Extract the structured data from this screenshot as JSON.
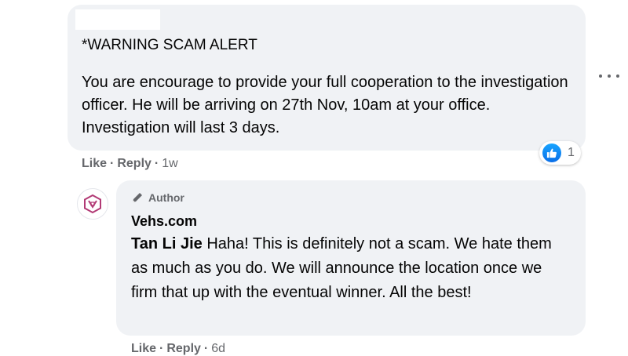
{
  "comment": {
    "title": "*WARNING SCAM ALERT",
    "body": "You are encourage to provide your full cooperation to the investigation officer. He will be arriving on 27th Nov, 10am at your office. Investigation will last 3 days.",
    "like_label": "Like",
    "reply_label": "Reply",
    "time": "1w",
    "reaction_icon": "thumbs-up-icon",
    "reaction_count": "1",
    "more_icon": "more-options-icon"
  },
  "reply": {
    "badge": "Author",
    "badge_icon": "pen-icon",
    "page_name": "Vehs.com",
    "mention": "Tan Li Jie",
    "text": " Haha! This is definitely not a scam. We hate them as much as you do. We will announce the location once we firm that up with the eventual winner. All the best!",
    "like_label": "Like",
    "reply_label": "Reply",
    "time": "6d",
    "avatar_icon": "vehs-logo-icon"
  },
  "colors": {
    "bubble": "#f0f2f5",
    "text": "#050505",
    "secondary": "#65676b",
    "like_blue": "#1877f2",
    "logo": "#b23a75"
  }
}
